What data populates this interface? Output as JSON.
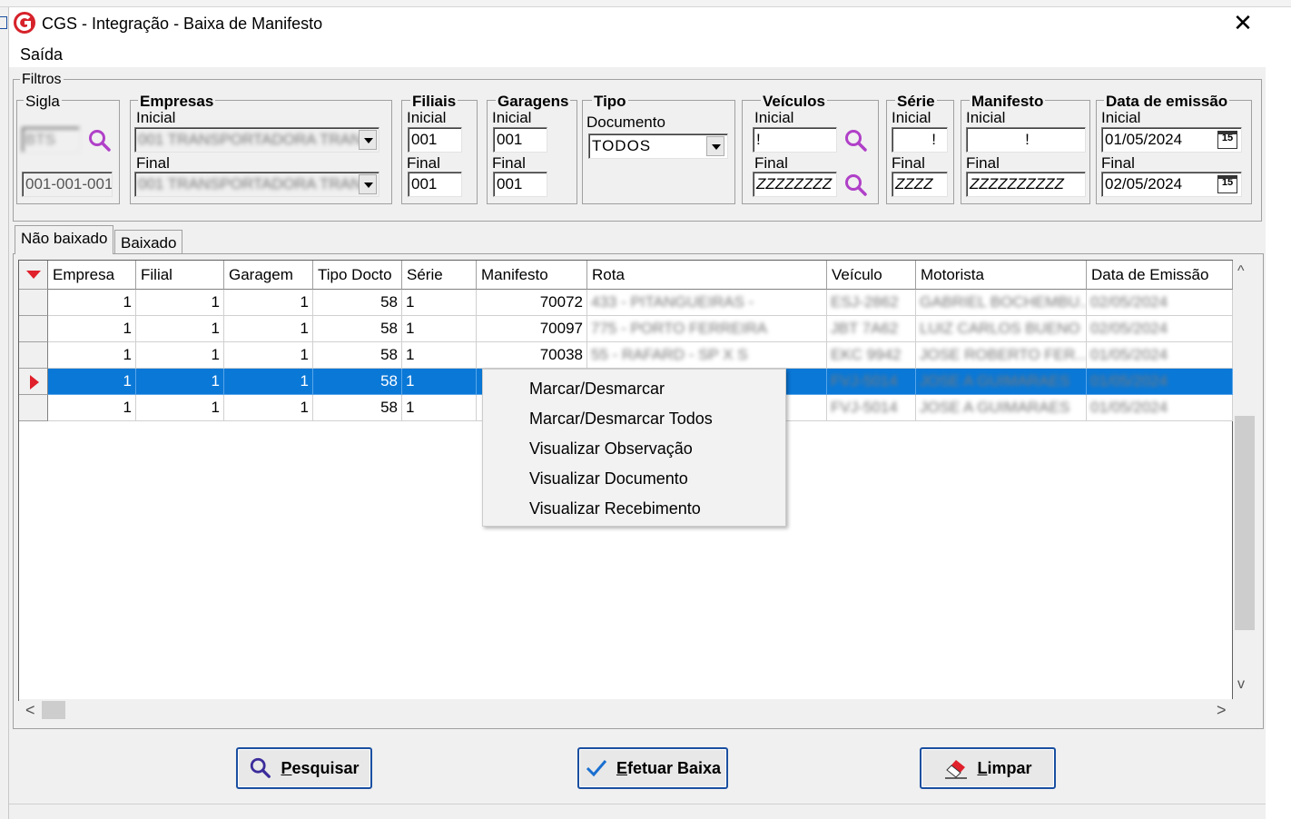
{
  "window": {
    "title": "CGS - Integração - Baixa de Manifesto",
    "close_glyph": "✕"
  },
  "menu": {
    "items": [
      "Saída"
    ]
  },
  "filtros": {
    "label": "Filtros",
    "sigla": {
      "title": "Sigla",
      "value": "BTS",
      "code": "001-001-001"
    },
    "empresas": {
      "title": "Empresas",
      "inicial_label": "Inicial",
      "final_label": "Final",
      "inicial_value": "001 TRANSPORTADORA TRAN",
      "final_value": "001 TRANSPORTADORA TRAN"
    },
    "filiais": {
      "title": "Filiais",
      "inicial_label": "Inicial",
      "final_label": "Final",
      "inicial_value": "001",
      "final_value": "001"
    },
    "garagens": {
      "title": "Garagens",
      "inicial_label": "Inicial",
      "final_label": "Final",
      "inicial_value": "001",
      "final_value": "001"
    },
    "tipo": {
      "title": "Tipo",
      "doc_label": "Documento",
      "value": "TODOS"
    },
    "veiculos": {
      "title": "Veículos",
      "inicial_label": "Inicial",
      "final_label": "Final",
      "inicial_value": "!",
      "final_value": "ZZZZZZZZ"
    },
    "serie": {
      "title": "Série",
      "inicial_label": "Inicial",
      "final_label": "Final",
      "inicial_value": "!",
      "final_value": "ZZZZ"
    },
    "manifesto": {
      "title": "Manifesto",
      "inicial_label": "Inicial",
      "final_label": "Final",
      "inicial_value": "!",
      "final_value": "ZZZZZZZZZZ"
    },
    "data_emissao": {
      "title": "Data de emissão",
      "inicial_label": "Inicial",
      "final_label": "Final",
      "inicial_value": "01/05/2024",
      "final_value": "02/05/2024",
      "cal_glyph": "15"
    }
  },
  "tabs": [
    {
      "label": "Não baixado",
      "active": true
    },
    {
      "label": "Baixado",
      "active": false
    }
  ],
  "grid": {
    "columns": [
      "Empresa",
      "Filial",
      "Garagem",
      "Tipo Docto",
      "Série",
      "Manifesto",
      "Rota",
      "Veículo",
      "Motorista",
      "Data de Emissão"
    ],
    "rows": [
      {
        "empresa": "1",
        "filial": "1",
        "garagem": "1",
        "tipo": "58",
        "serie": "1",
        "manifesto": "70072",
        "rota": "433 - PITANGUEIRAS -",
        "veiculo": "ESJ-2862",
        "motorista": "GABRIEL BOCHEMBU...",
        "data": "02/05/2024"
      },
      {
        "empresa": "1",
        "filial": "1",
        "garagem": "1",
        "tipo": "58",
        "serie": "1",
        "manifesto": "70097",
        "rota": "775 - PORTO FERREIRA",
        "veiculo": "JBT 7A62",
        "motorista": "LUIZ CARLOS BUENO",
        "data": "02/05/2024"
      },
      {
        "empresa": "1",
        "filial": "1",
        "garagem": "1",
        "tipo": "58",
        "serie": "1",
        "manifesto": "70038",
        "rota": "55 - RAFARD - SP X S",
        "veiculo": "EKC 9942",
        "motorista": "JOSE ROBERTO FER...",
        "data": "01/05/2024"
      },
      {
        "empresa": "1",
        "filial": "1",
        "garagem": "1",
        "tipo": "58",
        "serie": "1",
        "manifesto": "",
        "rota": "",
        "veiculo": "FVJ-5014",
        "motorista": "JOSE A GUIMARAES",
        "data": "01/05/2024"
      },
      {
        "empresa": "1",
        "filial": "1",
        "garagem": "1",
        "tipo": "58",
        "serie": "1",
        "manifesto": "",
        "rota": "",
        "veiculo": "FVJ-5014",
        "motorista": "JOSE A GUIMARAES",
        "data": "01/05/2024"
      }
    ],
    "selected_row": 3
  },
  "context_menu": [
    "Marcar/Desmarcar",
    "Marcar/Desmarcar Todos",
    "Visualizar Observação",
    "Visualizar Documento",
    "Visualizar Recebimento"
  ],
  "buttons": {
    "pesquisar": "Pesquisar",
    "baixa": "Efetuar Baixa",
    "limpar": "Limpar"
  },
  "scroll": {
    "up": "^",
    "down": "v",
    "left": "<",
    "right": ">"
  },
  "colors": {
    "accent": "#0a78d7",
    "logo": "#d6222a",
    "search_icon": "#b040c8"
  }
}
